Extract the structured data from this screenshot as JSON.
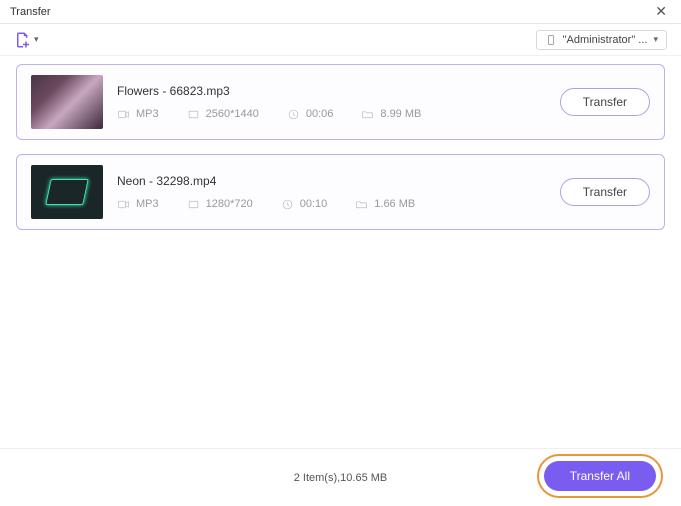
{
  "window": {
    "title": "Transfer"
  },
  "toolbar": {
    "device_label": "\"Administrator\" ..."
  },
  "items": [
    {
      "filename": "Flowers - 66823.mp3",
      "format": "MP3",
      "resolution": "2560*1440",
      "duration": "00:06",
      "size": "8.99 MB",
      "action": "Transfer"
    },
    {
      "filename": "Neon - 32298.mp4",
      "format": "MP3",
      "resolution": "1280*720",
      "duration": "00:10",
      "size": "1.66 MB",
      "action": "Transfer"
    }
  ],
  "footer": {
    "summary": "2 Item(s),10.65 MB",
    "transfer_all": "Transfer All"
  }
}
